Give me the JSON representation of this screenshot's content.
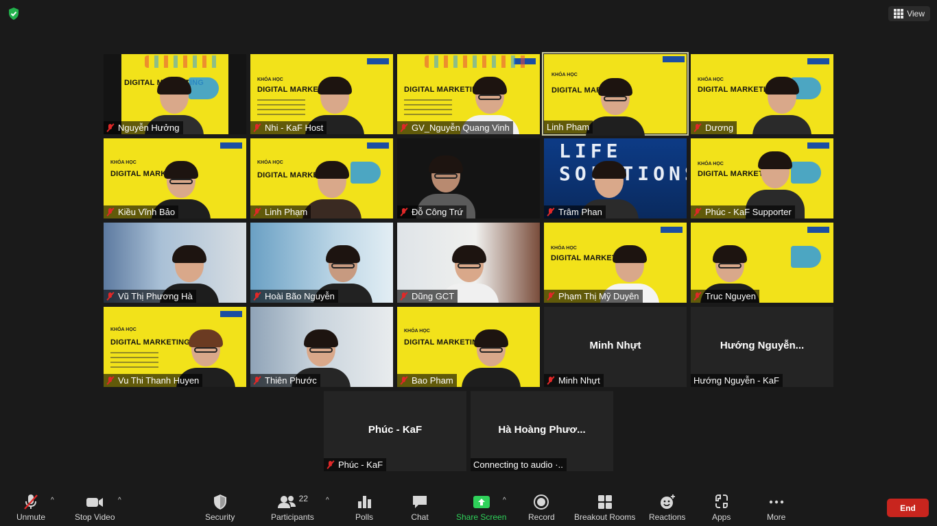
{
  "top_bar": {
    "view_label": "View"
  },
  "participants": [
    {
      "name": "Nguyễn Hưởng",
      "muted": true,
      "video": "poster"
    },
    {
      "name": "Nhi - KaF Host",
      "muted": true,
      "video": "poster"
    },
    {
      "name": "GV_Nguyễn Quang Vinh",
      "muted": true,
      "video": "poster"
    },
    {
      "name": "Linh Pham",
      "muted": false,
      "video": "poster",
      "active_speaker": true
    },
    {
      "name": "Dương",
      "muted": true,
      "video": "poster"
    },
    {
      "name": "Kiều Vĩnh Bảo",
      "muted": true,
      "video": "poster"
    },
    {
      "name": "Linh Phạm",
      "muted": true,
      "video": "poster"
    },
    {
      "name": "Đỗ Công Trứ",
      "muted": true,
      "video": "dark"
    },
    {
      "name": "Trâm Phan",
      "muted": true,
      "video": "blue"
    },
    {
      "name": "Phúc - KaF Supporter",
      "muted": true,
      "video": "poster"
    },
    {
      "name": "Vũ Thị Phương Hà",
      "muted": true,
      "video": "room"
    },
    {
      "name": "Hoài Bão Nguyễn",
      "muted": true,
      "video": "room"
    },
    {
      "name": "Dũng GCT",
      "muted": true,
      "video": "room"
    },
    {
      "name": "Phạm Thị Mỹ Duyên",
      "muted": true,
      "video": "poster"
    },
    {
      "name": "Truc Nguyen",
      "muted": true,
      "video": "poster"
    },
    {
      "name": "Vu Thi Thanh Huyen",
      "muted": true,
      "video": "poster"
    },
    {
      "name": "Thiên Phước",
      "muted": true,
      "video": "room"
    },
    {
      "name": "Bao Pham",
      "muted": true,
      "video": "poster"
    },
    {
      "name": "Minh Nhựt",
      "muted": true,
      "video": "off",
      "display_name": "Minh Nhựt"
    },
    {
      "name": "Hướng Nguyễn - KaF",
      "muted": false,
      "video": "off",
      "display_name": "Hướng  Nguyễn..."
    },
    {
      "name": "Phúc - KaF",
      "muted": true,
      "video": "off",
      "display_name": "Phúc - KaF"
    },
    {
      "name": "Connecting to audio ·..",
      "muted": false,
      "video": "off",
      "display_name": "Hà  Hoàng  Phươ..."
    }
  ],
  "poster": {
    "course_label": "KHÓA HỌC",
    "title": "DIGITAL MARKETING"
  },
  "blue_wall_text": "LIFE SOLUTIONS",
  "toolbar": {
    "unmute": "Unmute",
    "stop_video": "Stop Video",
    "security": "Security",
    "participants": "Participants",
    "participant_count": "22",
    "polls": "Polls",
    "chat": "Chat",
    "share_screen": "Share Screen",
    "record": "Record",
    "breakout_rooms": "Breakout Rooms",
    "reactions": "Reactions",
    "apps": "Apps",
    "more": "More",
    "end": "End"
  },
  "colors": {
    "background": "#1a1a1a",
    "poster_yellow": "#f2e21a",
    "mute_red": "#e02828",
    "share_green": "#2fd15a",
    "end_red": "#c8251e",
    "security_green": "#22b14c"
  }
}
